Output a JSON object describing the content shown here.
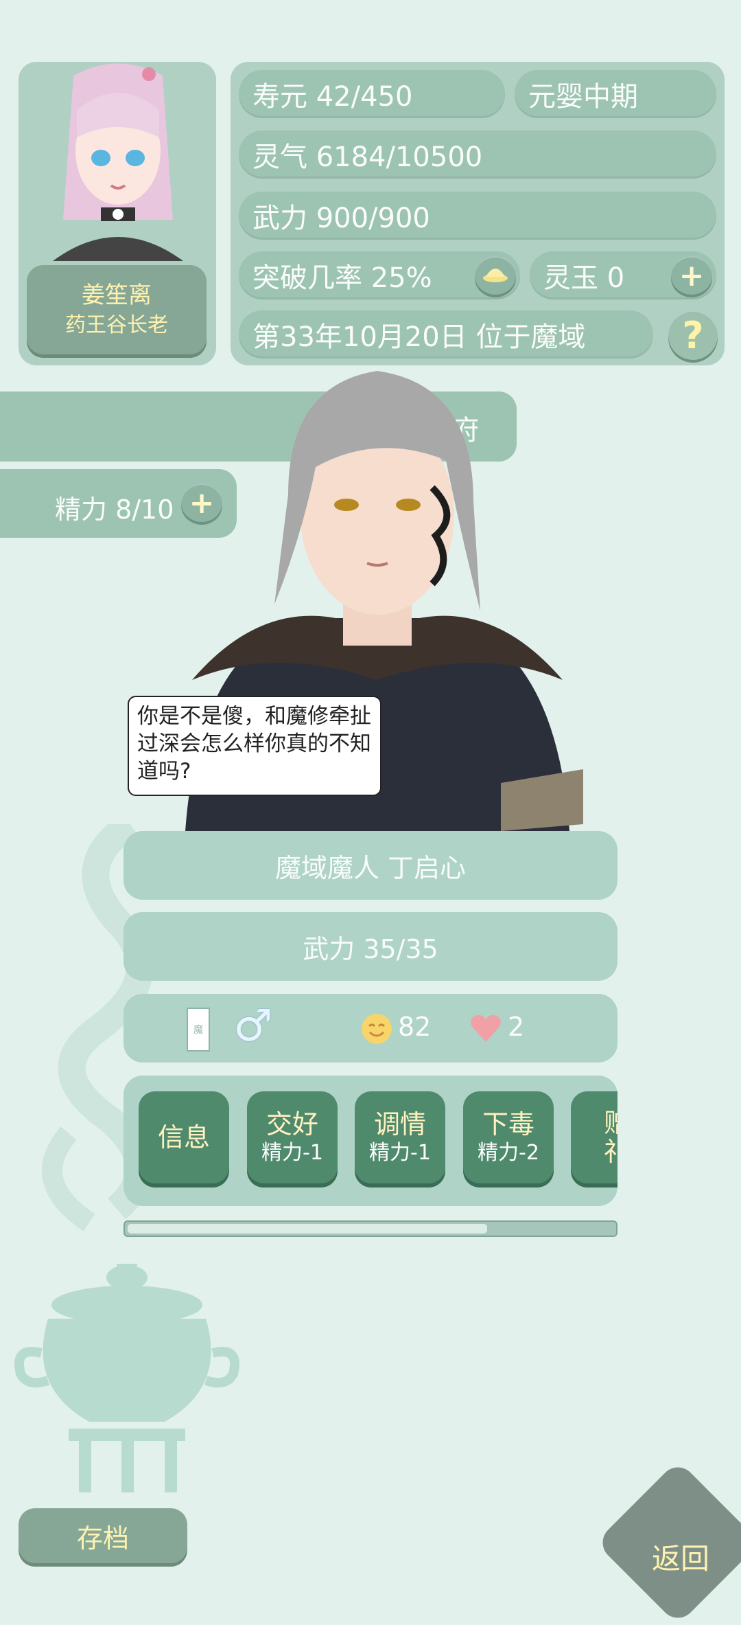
{
  "player": {
    "name": "姜笙离",
    "title": "药王谷长老"
  },
  "stats": {
    "lifespan": "寿元 42/450",
    "realm": "元婴中期",
    "spirit_qi": "灵气 6184/10500",
    "force": "武力 900/900",
    "breakthrough": "突破几率 25%",
    "spirit_jade": "灵玉 0",
    "date_location": "第33年10月20日 位于魔域"
  },
  "location_tab": "洞府",
  "energy": "精力 8/10",
  "npc": {
    "speech": "你是不是傻，和魔修牵扯过深会怎么样你真的不知道吗?",
    "name_line": "魔域魔人 丁启心",
    "force": "武力 35/35",
    "card_glyph": "魔",
    "gender_symbol": "♂",
    "mood_value": "82",
    "affection_value": "2"
  },
  "actions": [
    {
      "label": "信息",
      "cost": ""
    },
    {
      "label": "交好",
      "cost": "精力-1"
    },
    {
      "label": "调情",
      "cost": "精力-1"
    },
    {
      "label": "下毒",
      "cost": "精力-2"
    },
    {
      "label": "赠礼",
      "cost": ""
    }
  ],
  "scroll_progress": 0.74,
  "save_label": "存档",
  "back_label": "返回",
  "icons": {
    "plus": "+",
    "help": "?"
  },
  "colors": {
    "background": "#e3f1ec",
    "pill": "#9dc3b3",
    "action_button": "#4f8a6d",
    "accent_text": "#fff2c0"
  }
}
